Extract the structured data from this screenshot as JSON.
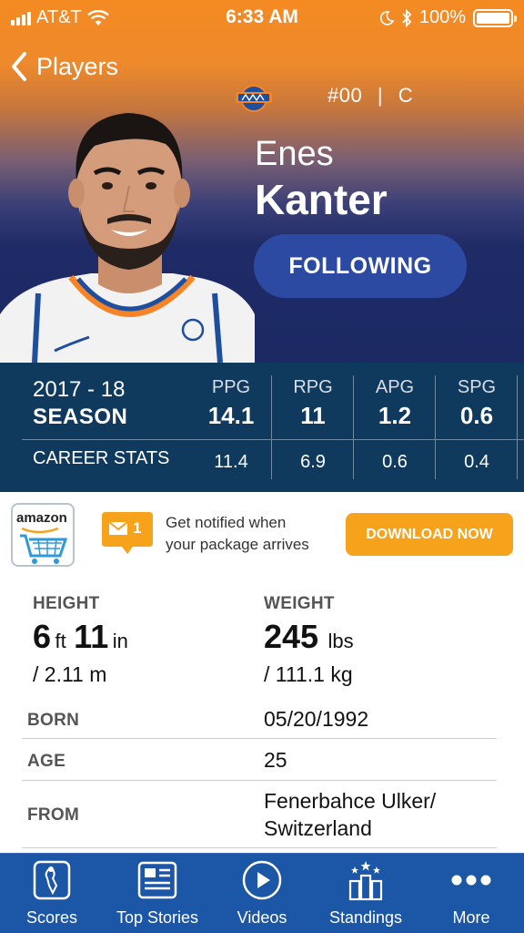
{
  "status_bar": {
    "carrier": "AT&T",
    "time": "6:33 AM",
    "battery": "100%"
  },
  "nav": {
    "back_label": "Players"
  },
  "player": {
    "jersey": "#00",
    "position": "C",
    "separator": "|",
    "first_name": "Enes",
    "last_name": "Kanter",
    "follow_label": "FOLLOWING"
  },
  "stats": {
    "season_year": "2017 - 18",
    "season_label": "SEASON",
    "career_label": "CAREER STATS",
    "columns": [
      {
        "header": "PPG",
        "season": "14.1",
        "career": "11.4"
      },
      {
        "header": "RPG",
        "season": "11",
        "career": "6.9"
      },
      {
        "header": "APG",
        "season": "1.2",
        "career": "0.6"
      },
      {
        "header": "SPG",
        "season": "0.6",
        "career": "0.4"
      }
    ]
  },
  "ad": {
    "brand": "amazon",
    "badge_count": "1",
    "line1": "Get notified when",
    "line2": "your package arrives",
    "cta": "DOWNLOAD NOW"
  },
  "bio": {
    "height_label": "HEIGHT",
    "height_ft": "6",
    "height_ft_unit": "ft",
    "height_in": "11",
    "height_in_unit": "in",
    "height_metric": "/ 2.11 m",
    "weight_label": "WEIGHT",
    "weight_value": "245",
    "weight_unit": "lbs",
    "weight_metric": "/ 111.1 kg",
    "born_label": "BORN",
    "born_value": "05/20/1992",
    "age_label": "AGE",
    "age_value": "25",
    "from_label": "FROM",
    "from_line1": "Fenerbahce Ulker/",
    "from_line2": "Switzerland"
  },
  "tabs": [
    {
      "label": "Scores",
      "icon": "scores-icon"
    },
    {
      "label": "Top Stories",
      "icon": "top-stories-icon"
    },
    {
      "label": "Videos",
      "icon": "videos-icon"
    },
    {
      "label": "Standings",
      "icon": "standings-icon"
    },
    {
      "label": "More",
      "icon": "more-icon"
    }
  ],
  "colors": {
    "header_orange": "#f48a22",
    "header_navy": "#1b2964",
    "follow_button": "#2d4aa3",
    "stats_band": "#0f3a5d",
    "ad_button": "#f7a21b",
    "tab_bar": "#1c56a6"
  }
}
